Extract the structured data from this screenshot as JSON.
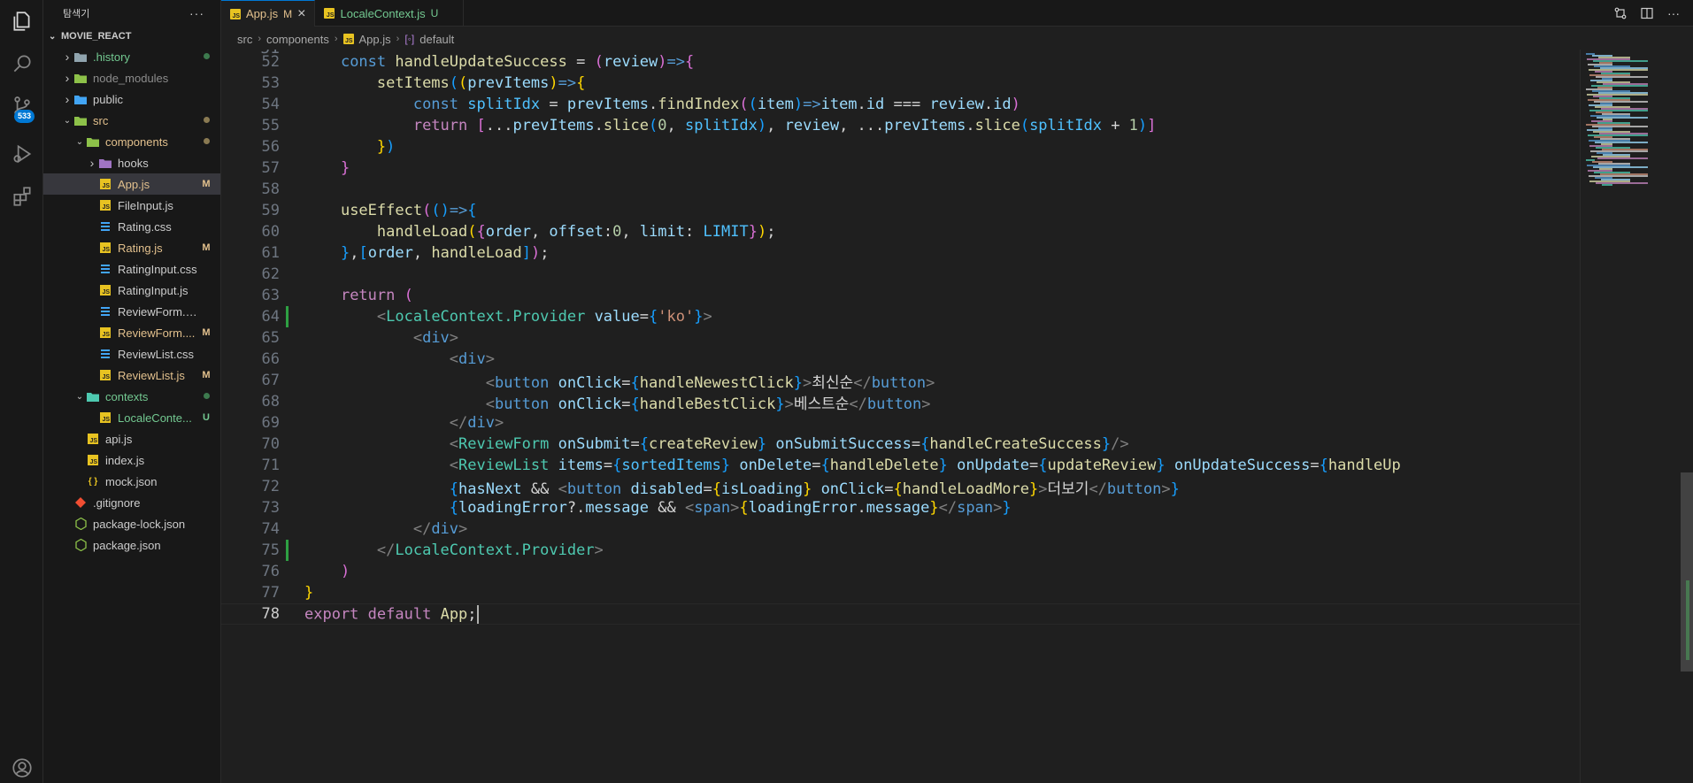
{
  "explorer": {
    "title": "탐색기",
    "project": "MOVIE_REACT",
    "items": [
      {
        "label": ".history",
        "type": "folder",
        "depth": 1,
        "open": false,
        "color": "#73c991",
        "status": "dot",
        "status_color": "#3d7a4e",
        "icon": "folder-icon"
      },
      {
        "label": "node_modules",
        "type": "folder",
        "depth": 1,
        "open": false,
        "color": "#8c8c8c",
        "status": "",
        "icon": "folder-node-icon"
      },
      {
        "label": "public",
        "type": "folder",
        "depth": 1,
        "open": false,
        "color": "#cccccc",
        "status": "",
        "icon": "folder-public-icon"
      },
      {
        "label": "src",
        "type": "folder",
        "depth": 1,
        "open": true,
        "color": "#e2c08d",
        "status": "dot",
        "status_color": "#8a7a52",
        "icon": "folder-src-icon"
      },
      {
        "label": "components",
        "type": "folder",
        "depth": 2,
        "open": true,
        "color": "#e2c08d",
        "status": "dot",
        "status_color": "#8a7a52",
        "icon": "folder-components-icon"
      },
      {
        "label": "hooks",
        "type": "folder",
        "depth": 3,
        "open": false,
        "color": "#cccccc",
        "status": "",
        "icon": "folder-hooks-icon"
      },
      {
        "label": "App.js",
        "type": "js",
        "depth": 3,
        "color": "#e2c08d",
        "status": "M",
        "status_color": "#e2c08d",
        "selected": true,
        "icon": "js-file-icon"
      },
      {
        "label": "FileInput.js",
        "type": "js",
        "depth": 3,
        "color": "#cccccc",
        "status": "",
        "icon": "js-file-icon"
      },
      {
        "label": "Rating.css",
        "type": "css",
        "depth": 3,
        "color": "#cccccc",
        "status": "",
        "icon": "css-file-icon"
      },
      {
        "label": "Rating.js",
        "type": "js",
        "depth": 3,
        "color": "#e2c08d",
        "status": "M",
        "status_color": "#e2c08d",
        "icon": "js-file-icon"
      },
      {
        "label": "RatingInput.css",
        "type": "css",
        "depth": 3,
        "color": "#cccccc",
        "status": "",
        "icon": "css-file-icon"
      },
      {
        "label": "RatingInput.js",
        "type": "js",
        "depth": 3,
        "color": "#cccccc",
        "status": "",
        "icon": "js-file-icon"
      },
      {
        "label": "ReviewForm.css",
        "type": "css",
        "depth": 3,
        "color": "#cccccc",
        "status": "",
        "icon": "css-file-icon"
      },
      {
        "label": "ReviewForm....",
        "type": "js",
        "depth": 3,
        "color": "#e2c08d",
        "status": "M",
        "status_color": "#e2c08d",
        "icon": "js-file-icon"
      },
      {
        "label": "ReviewList.css",
        "type": "css",
        "depth": 3,
        "color": "#cccccc",
        "status": "",
        "icon": "css-file-icon"
      },
      {
        "label": "ReviewList.js",
        "type": "js",
        "depth": 3,
        "color": "#e2c08d",
        "status": "M",
        "status_color": "#e2c08d",
        "icon": "js-file-icon"
      },
      {
        "label": "contexts",
        "type": "folder",
        "depth": 2,
        "open": true,
        "color": "#73c991",
        "status": "dot",
        "status_color": "#3d7a4e",
        "icon": "folder-contexts-icon"
      },
      {
        "label": "LocaleConte...",
        "type": "js",
        "depth": 3,
        "color": "#73c991",
        "status": "U",
        "status_color": "#73c991",
        "icon": "js-file-icon"
      },
      {
        "label": "api.js",
        "type": "js",
        "depth": 2,
        "color": "#cccccc",
        "status": "",
        "icon": "js-file-icon"
      },
      {
        "label": "index.js",
        "type": "js",
        "depth": 2,
        "color": "#cccccc",
        "status": "",
        "icon": "js-file-icon"
      },
      {
        "label": "mock.json",
        "type": "json",
        "depth": 2,
        "color": "#cccccc",
        "status": "",
        "icon": "json-file-icon"
      },
      {
        "label": ".gitignore",
        "type": "git",
        "depth": 1,
        "color": "#cccccc",
        "status": "",
        "icon": "git-file-icon"
      },
      {
        "label": "package-lock.json",
        "type": "node",
        "depth": 1,
        "color": "#cccccc",
        "status": "",
        "icon": "nodejs-file-icon"
      },
      {
        "label": "package.json",
        "type": "node",
        "depth": 1,
        "color": "#cccccc",
        "status": "",
        "icon": "nodejs-file-icon"
      }
    ]
  },
  "activity": {
    "scm_badge": "533"
  },
  "tabs": [
    {
      "label": "App.js",
      "status": "M",
      "active": true,
      "color": "#e2c08d",
      "close": "×"
    },
    {
      "label": "LocaleContext.js",
      "status": "U",
      "active": false,
      "color": "#73c991",
      "close": ""
    }
  ],
  "breadcrumb": [
    "src",
    "components",
    "App.js",
    "default"
  ],
  "editor": {
    "first_partial_line": "51",
    "current_line": 78,
    "modified_lines": [
      64,
      75
    ],
    "lines": [
      {
        "n": 52,
        "html": "    <span class='k'>const</span> <span class='fn'>handleUpdateSuccess</span> <span class='p'>=</span> <span class='b2'>(</span><span class='v'>review</span><span class='b2'>)</span><span class='k'>=&gt;</span><span class='b2'>{</span>"
      },
      {
        "n": 53,
        "html": "        <span class='fn'>setItems</span><span class='b3'>(</span><span class='b1'>(</span><span class='v'>prevItems</span><span class='b1'>)</span><span class='k'>=&gt;</span><span class='b1'>{</span>"
      },
      {
        "n": 54,
        "html": "            <span class='k'>const</span> <span class='c'>splitIdx</span> <span class='p'>=</span> <span class='v'>prevItems</span>.<span class='fn'>findIndex</span><span class='b2'>(</span><span class='b3'>(</span><span class='v'>item</span><span class='b3'>)</span><span class='k'>=&gt;</span><span class='v'>item</span>.<span class='v'>id</span> <span class='p'>===</span> <span class='v'>review</span>.<span class='v'>id</span><span class='b2'>)</span>"
      },
      {
        "n": 55,
        "html": "            <span class='ctl'>return</span> <span class='b2'>[</span>...<span class='v'>prevItems</span>.<span class='fn'>slice</span><span class='b3'>(</span><span class='n'>0</span>, <span class='c'>splitIdx</span><span class='b3'>)</span>, <span class='v'>review</span>, ...<span class='v'>prevItems</span>.<span class='fn'>slice</span><span class='b3'>(</span><span class='c'>splitIdx</span> + <span class='n'>1</span><span class='b3'>)</span><span class='b2'>]</span>"
      },
      {
        "n": 56,
        "html": "        <span class='b1'>}</span><span class='b3'>)</span>"
      },
      {
        "n": 57,
        "html": "    <span class='b2'>}</span>"
      },
      {
        "n": 58,
        "html": ""
      },
      {
        "n": 59,
        "html": "    <span class='fn'>useEffect</span><span class='b2'>(</span><span class='b3'>()</span><span class='k'>=&gt;</span><span class='b3'>{</span>"
      },
      {
        "n": 60,
        "html": "        <span class='fn'>handleLoad</span><span class='b1'>(</span><span class='b2'>{</span><span class='v'>order</span>, <span class='v'>offset</span>:<span class='n'>0</span>, <span class='v'>limit</span>: <span class='c'>LIMIT</span><span class='b2'>}</span><span class='b1'>)</span>;"
      },
      {
        "n": 61,
        "html": "    <span class='b3'>}</span>,<span class='b3'>[</span><span class='v'>order</span>, <span class='fn'>handleLoad</span><span class='b3'>]</span><span class='b2'>)</span>;"
      },
      {
        "n": 62,
        "html": ""
      },
      {
        "n": 63,
        "html": "    <span class='ctl'>return</span> <span class='b2'>(</span>"
      },
      {
        "n": 64,
        "html": "        <span class='tg'>&lt;</span><span class='cmp'>LocaleContext.Provider</span> <span class='at'>value</span>=<span class='b3'>{</span><span class='s'>'ko'</span><span class='b3'>}</span><span class='tg'>&gt;</span>"
      },
      {
        "n": 65,
        "html": "            <span class='tg'>&lt;</span><span class='t'>div</span><span class='tg'>&gt;</span>"
      },
      {
        "n": 66,
        "html": "                <span class='tg'>&lt;</span><span class='t'>div</span><span class='tg'>&gt;</span>"
      },
      {
        "n": 67,
        "html": "                    <span class='tg'>&lt;</span><span class='t'>button</span> <span class='at'>onClick</span>=<span class='b3'>{</span><span class='fn'>handleNewestClick</span><span class='b3'>}</span><span class='tg'>&gt;</span><span class='tx'>최신순</span><span class='tg'>&lt;/</span><span class='t'>button</span><span class='tg'>&gt;</span>"
      },
      {
        "n": 68,
        "html": "                    <span class='tg'>&lt;</span><span class='t'>button</span> <span class='at'>onClick</span>=<span class='b3'>{</span><span class='fn'>handleBestClick</span><span class='b3'>}</span><span class='tg'>&gt;</span><span class='tx'>베스트순</span><span class='tg'>&lt;/</span><span class='t'>button</span><span class='tg'>&gt;</span>"
      },
      {
        "n": 69,
        "html": "                <span class='tg'>&lt;/</span><span class='t'>div</span><span class='tg'>&gt;</span>"
      },
      {
        "n": 70,
        "html": "                <span class='tg'>&lt;</span><span class='cmp'>ReviewForm</span> <span class='at'>onSubmit</span>=<span class='b3'>{</span><span class='fn'>createReview</span><span class='b3'>}</span> <span class='at'>onSubmitSuccess</span>=<span class='b3'>{</span><span class='fn'>handleCreateSuccess</span><span class='b3'>}</span><span class='tg'>/&gt;</span>"
      },
      {
        "n": 71,
        "html": "                <span class='tg'>&lt;</span><span class='cmp'>ReviewList</span> <span class='at'>items</span>=<span class='b3'>{</span><span class='c'>sortedItems</span><span class='b3'>}</span> <span class='at'>onDelete</span>=<span class='b3'>{</span><span class='fn'>handleDelete</span><span class='b3'>}</span> <span class='at'>onUpdate</span>=<span class='b3'>{</span><span class='fn'>updateReview</span><span class='b3'>}</span> <span class='at'>onUpdateSuccess</span>=<span class='b3'>{</span><span class='fn'>handleUp</span>"
      },
      {
        "n": 72,
        "html": "                <span class='b3'>{</span><span class='v'>hasNext</span> &amp;&amp; <span class='tg'>&lt;</span><span class='t'>button</span> <span class='at'>disabled</span>=<span class='b1'>{</span><span class='v'>isLoading</span><span class='b1'>}</span> <span class='at'>onClick</span>=<span class='b1'>{</span><span class='fn'>handleLoadMore</span><span class='b1'>}</span><span class='tg'>&gt;</span><span class='tx'>더보기</span><span class='tg'>&lt;/</span><span class='t'>button</span><span class='tg'>&gt;</span><span class='b3'>}</span>"
      },
      {
        "n": 73,
        "html": "                <span class='b3'>{</span><span class='v'>loadingError</span>?.<span class='v'>message</span> &amp;&amp; <span class='tg'>&lt;</span><span class='t'>span</span><span class='tg'>&gt;</span><span class='b1'>{</span><span class='v'>loadingError</span>.<span class='v'>message</span><span class='b1'>}</span><span class='tg'>&lt;/</span><span class='t'>span</span><span class='tg'>&gt;</span><span class='b3'>}</span>"
      },
      {
        "n": 74,
        "html": "            <span class='tg'>&lt;/</span><span class='t'>div</span><span class='tg'>&gt;</span>"
      },
      {
        "n": 75,
        "html": "        <span class='tg'>&lt;/</span><span class='cmp'>LocaleContext.Provider</span><span class='tg'>&gt;</span>"
      },
      {
        "n": 76,
        "html": "    <span class='b2'>)</span>"
      },
      {
        "n": 77,
        "html": "<span class='b1'>}</span>"
      },
      {
        "n": 78,
        "html": "<span class='ctl'>export</span> <span class='ctl'>default</span> <span class='fn'>App</span>;"
      }
    ]
  }
}
